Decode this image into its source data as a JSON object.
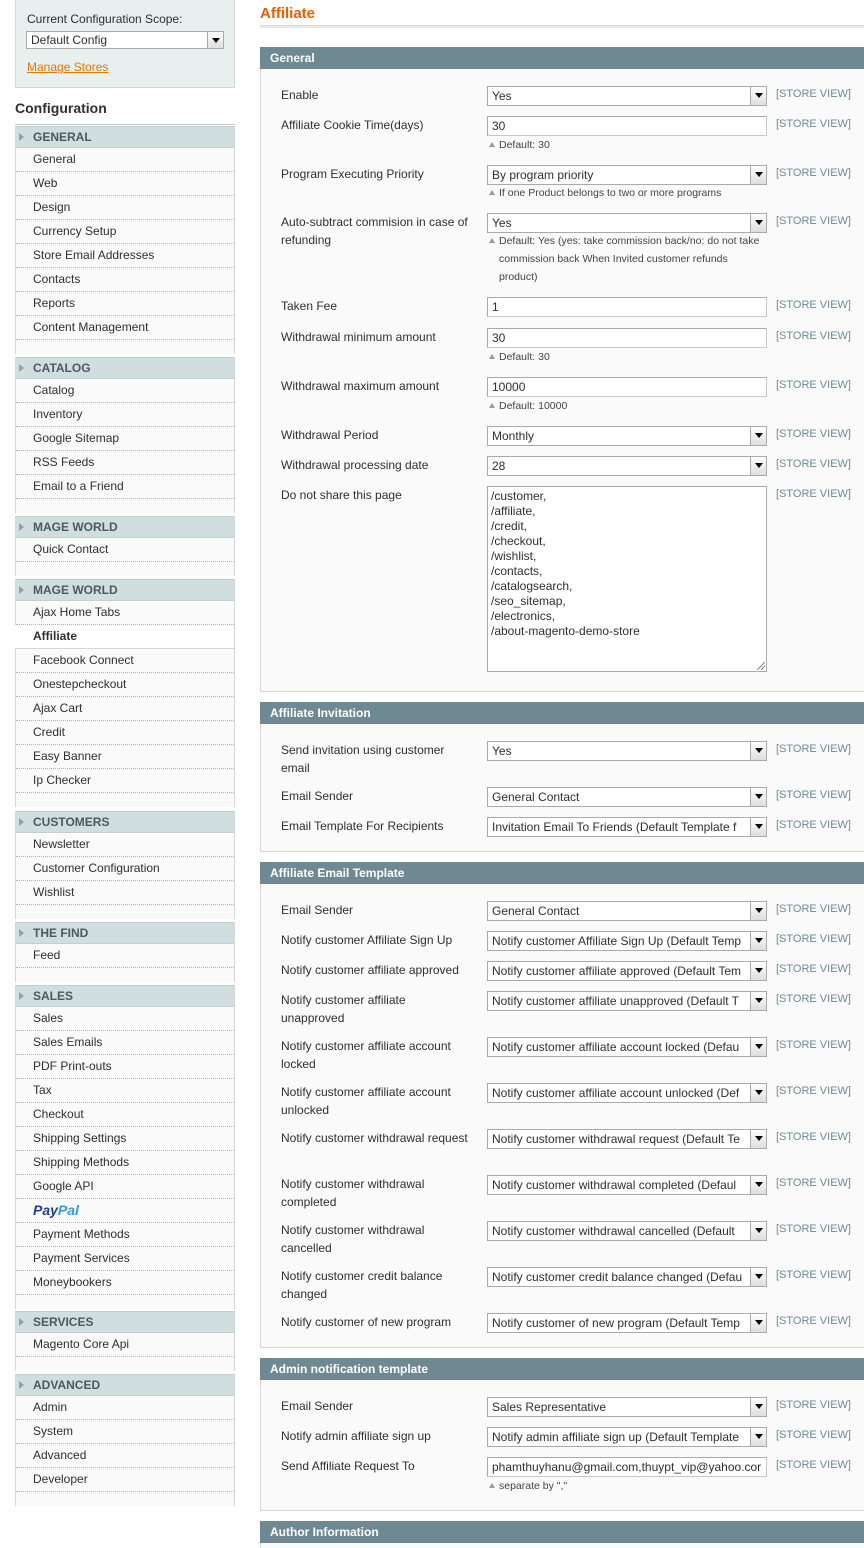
{
  "sidebar": {
    "scope_label": "Current Configuration Scope:",
    "scope_value": "Default Config",
    "manage_stores": "Manage Stores",
    "config_title": "Configuration",
    "groups": [
      {
        "title": "GENERAL",
        "items": [
          "General",
          "Web",
          "Design",
          "Currency Setup",
          "Store Email Addresses",
          "Contacts",
          "Reports",
          "Content Management"
        ]
      },
      {
        "title": "CATALOG",
        "items": [
          "Catalog",
          "Inventory",
          "Google Sitemap",
          "RSS Feeds",
          "Email to a Friend"
        ]
      },
      {
        "title": "MAGE WORLD",
        "items": [
          "Quick Contact"
        ]
      },
      {
        "title": "MAGE WORLD",
        "items": [
          "Ajax Home Tabs",
          "Affiliate",
          "Facebook Connect",
          "Onestepcheckout",
          "Ajax Cart",
          "Credit",
          "Easy Banner",
          "Ip Checker"
        ]
      },
      {
        "title": "CUSTOMERS",
        "items": [
          "Newsletter",
          "Customer Configuration",
          "Wishlist"
        ]
      },
      {
        "title": "THE FIND",
        "items": [
          "Feed"
        ]
      },
      {
        "title": "SALES",
        "items": [
          "Sales",
          "Sales Emails",
          "PDF Print-outs",
          "Tax",
          "Checkout",
          "Shipping Settings",
          "Shipping Methods",
          "Google API",
          "PayPal",
          "Payment Methods",
          "Payment Services",
          "Moneybookers"
        ]
      },
      {
        "title": "SERVICES",
        "items": [
          "Magento Core Api"
        ]
      },
      {
        "title": "ADVANCED",
        "items": [
          "Admin",
          "System",
          "Advanced",
          "Developer"
        ]
      }
    ],
    "active_item": "Affiliate"
  },
  "main": {
    "page_title": "Affiliate",
    "store_view": "[STORE VIEW]",
    "general": {
      "title": "General",
      "enable_label": "Enable",
      "enable_value": "Yes",
      "cookie_label": "Affiliate Cookie Time(days)",
      "cookie_value": "30",
      "cookie_note": "Default: 30",
      "priority_label": "Program Executing Priority",
      "priority_value": "By program priority",
      "priority_note": "If one Product belongs to two or more programs",
      "autosub_label": "Auto-subtract commision in case of refunding",
      "autosub_value": "Yes",
      "autosub_note": "Default: Yes (yes: take commission back/no: do not take commission back When Invited customer refunds product)",
      "fee_label": "Taken Fee",
      "fee_value": "1",
      "wmin_label": "Withdrawal minimum amount",
      "wmin_value": "30",
      "wmin_note": "Default: 30",
      "wmax_label": "Withdrawal maximum amount",
      "wmax_value": "10000",
      "wmax_note": "Default: 10000",
      "period_label": "Withdrawal Period",
      "period_value": "Monthly",
      "pdate_label": "Withdrawal processing date",
      "pdate_value": "28",
      "noshare_label": "Do not share this page",
      "noshare_lines": [
        "/customer,",
        "/affiliate,",
        "/credit,",
        "/checkout,",
        "/wishlist,",
        "/contacts,",
        "/catalogsearch,",
        "/seo_sitemap,",
        "/electronics,",
        "/about-magento-demo-store"
      ]
    },
    "invitation": {
      "title": "Affiliate Invitation",
      "send_label": "Send invitation using customer email",
      "send_value": "Yes",
      "sender_label": "Email Sender",
      "sender_value": "General Contact",
      "tpl_label": "Email Template For Recipients",
      "tpl_value": "Invitation Email To Friends (Default Template f"
    },
    "email_tpl": {
      "title": "Affiliate Email Template",
      "rows": [
        {
          "label": "Email Sender",
          "value": "General Contact"
        },
        {
          "label": "Notify customer Affiliate Sign Up",
          "value": "Notify customer Affiliate Sign Up (Default Temp"
        },
        {
          "label": "Notify customer affiliate approved",
          "value": "Notify customer affiliate approved (Default Tem"
        },
        {
          "label": "Notify customer affiliate unapproved",
          "value": "Notify customer affiliate unapproved (Default T"
        },
        {
          "label": "Notify customer affiliate account locked",
          "value": "Notify customer affiliate account locked (Defau"
        },
        {
          "label": "Notify customer affiliate account unlocked",
          "value": "Notify customer affiliate account unlocked (Def"
        },
        {
          "label": "Notify customer withdrawal request",
          "value": "Notify customer withdrawal request (Default Te"
        },
        {
          "label": "Notify customer withdrawal completed",
          "value": "Notify customer withdrawal completed (Defaul"
        },
        {
          "label": "Notify customer withdrawal cancelled",
          "value": "Notify customer withdrawal cancelled (Default"
        },
        {
          "label": "Notify customer credit balance changed",
          "value": "Notify customer credit balance changed (Defau"
        },
        {
          "label": "Notify customer of new program",
          "value": "Notify customer of new program (Default Temp"
        }
      ]
    },
    "admin_tpl": {
      "title": "Admin notification template",
      "sender_label": "Email Sender",
      "sender_value": "Sales Representative",
      "signup_label": "Notify admin affiliate sign up",
      "signup_value": "Notify admin affiliate sign up (Default Template",
      "req_label": "Send Affiliate Request To",
      "req_value": "phamthuyhanu@gmail.com,thuypt_vip@yahoo.cor",
      "req_note": "separate by \",\""
    },
    "author": {
      "title": "Author Information"
    }
  }
}
